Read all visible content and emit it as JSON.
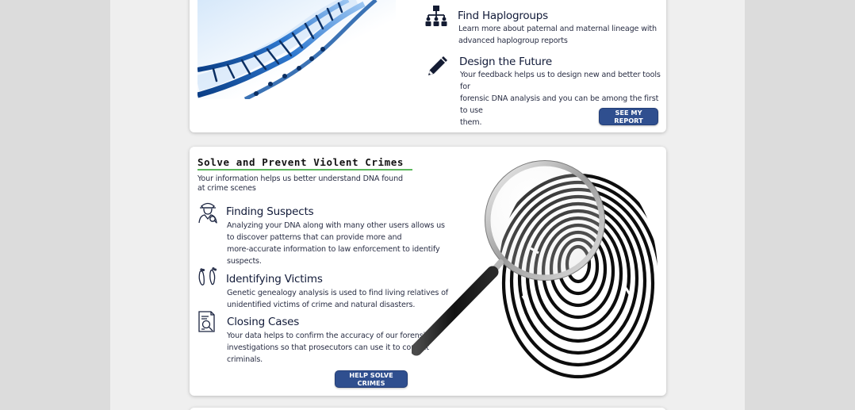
{
  "report_card": {
    "features": [
      {
        "icon": "hierarchy-icon",
        "title": "Find Haplogroups",
        "description": [
          "Learn more about paternal and maternal lineage with",
          "advanced haplogroup reports"
        ]
      },
      {
        "icon": "pencil-icon",
        "title": "Design the Future",
        "description": [
          "Your feedback helps us to design new and better tools for",
          "forensic DNA analysis and you can be among the first to use",
          "them."
        ]
      }
    ],
    "button_label": "SEE MY REPORT"
  },
  "crimes_card": {
    "heading": "Solve and Prevent Violent Crimes",
    "intro": "Your information helps us better understand DNA found at crime scenes",
    "features": [
      {
        "icon": "detective-icon",
        "title": "Finding Suspects",
        "description": [
          "Analyzing your DNA along with many other users allows us",
          "to discover patterns that can provide more and",
          "more-accurate information to law enforcement to identify",
          "suspects."
        ]
      },
      {
        "icon": "footprints-icon",
        "title": "Identifying Victims",
        "description": [
          "Genetic genealogy analysis is used to find living relatives of",
          "unidentified victims of crime and natural disasters."
        ]
      },
      {
        "icon": "case-file-icon",
        "title": "Closing Cases",
        "description": [
          "Your data helps to confirm the accuracy of our forensic",
          "investigations so that prosecutors can use it to convict",
          "criminals."
        ]
      }
    ],
    "button_label": "HELP SOLVE CRIMES"
  },
  "colors": {
    "button": "#2f4f8f",
    "heading_rule": "#5cb85c",
    "page_background": "#dcdcdc",
    "card": "#ffffff"
  }
}
